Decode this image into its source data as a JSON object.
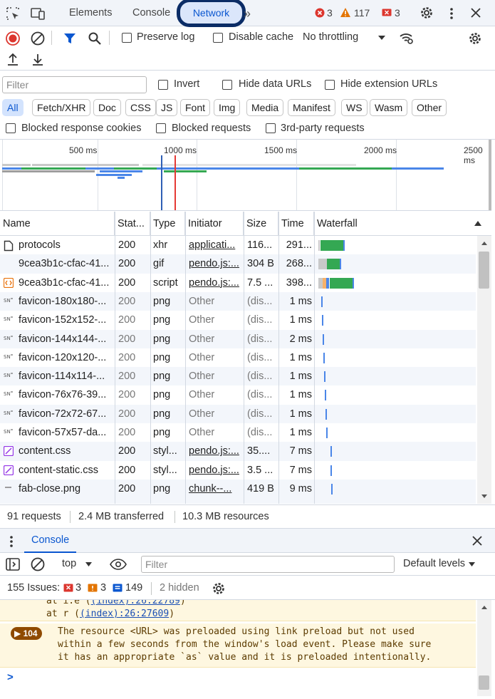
{
  "top_tabs": [
    "Elements",
    "Console",
    "Network"
  ],
  "counts": {
    "errors": "3",
    "warnings": "117",
    "issues": "3"
  },
  "toolbar": {
    "preserve_log": "Preserve log",
    "disable_cache": "Disable cache",
    "throttling": "No throttling"
  },
  "filter": {
    "placeholder": "Filter",
    "invert": "Invert",
    "hide_data_urls": "Hide data URLs",
    "hide_extension_urls": "Hide extension URLs"
  },
  "types": [
    "All",
    "Fetch/XHR",
    "Doc",
    "CSS",
    "JS",
    "Font",
    "Img",
    "Media",
    "Manifest",
    "WS",
    "Wasm",
    "Other"
  ],
  "blocked": {
    "cookies": "Blocked response cookies",
    "requests": "Blocked requests",
    "third_party": "3rd-party requests"
  },
  "overview": {
    "ticks": [
      "500 ms",
      "1000 ms",
      "1500 ms",
      "2000 ms",
      "2500 ms"
    ]
  },
  "columns": [
    "Name",
    "Stat...",
    "Type",
    "Initiator",
    "Size",
    "Time",
    "Waterfall"
  ],
  "rows": [
    {
      "name": "protocols",
      "status": "200",
      "type": "xhr",
      "initiator": "applicati...",
      "size": "116...",
      "time": "291...",
      "icon": "document-icon"
    },
    {
      "name": "9cea3b1c-cfac-41...",
      "status": "200",
      "type": "gif",
      "initiator": "pendo.js:...",
      "size": "304 B",
      "time": "268...",
      "icon": "none"
    },
    {
      "name": "9cea3b1c-cfac-41...",
      "status": "200",
      "type": "script",
      "initiator": "pendo.js:...",
      "size": "7.5 ...",
      "time": "398...",
      "icon": "script-icon"
    },
    {
      "name": "favicon-180x180-...",
      "status": "200",
      "type": "png",
      "initiator": "Other",
      "size": "(dis...",
      "time": "1 ms",
      "icon": "image-icon"
    },
    {
      "name": "favicon-152x152-...",
      "status": "200",
      "type": "png",
      "initiator": "Other",
      "size": "(dis...",
      "time": "1 ms",
      "icon": "image-icon"
    },
    {
      "name": "favicon-144x144-...",
      "status": "200",
      "type": "png",
      "initiator": "Other",
      "size": "(dis...",
      "time": "2 ms",
      "icon": "image-icon"
    },
    {
      "name": "favicon-120x120-...",
      "status": "200",
      "type": "png",
      "initiator": "Other",
      "size": "(dis...",
      "time": "1 ms",
      "icon": "image-icon"
    },
    {
      "name": "favicon-114x114-...",
      "status": "200",
      "type": "png",
      "initiator": "Other",
      "size": "(dis...",
      "time": "1 ms",
      "icon": "image-icon"
    },
    {
      "name": "favicon-76x76-39...",
      "status": "200",
      "type": "png",
      "initiator": "Other",
      "size": "(dis...",
      "time": "1 ms",
      "icon": "image-icon"
    },
    {
      "name": "favicon-72x72-67...",
      "status": "200",
      "type": "png",
      "initiator": "Other",
      "size": "(dis...",
      "time": "1 ms",
      "icon": "image-icon"
    },
    {
      "name": "favicon-57x57-da...",
      "status": "200",
      "type": "png",
      "initiator": "Other",
      "size": "(dis...",
      "time": "1 ms",
      "icon": "image-icon"
    },
    {
      "name": "content.css",
      "status": "200",
      "type": "styl...",
      "initiator": "pendo.js:...",
      "size": "35....",
      "time": "7 ms",
      "icon": "stylesheet-icon"
    },
    {
      "name": "content-static.css",
      "status": "200",
      "type": "styl...",
      "initiator": "pendo.js:...",
      "size": "3.5 ...",
      "time": "7 ms",
      "icon": "stylesheet-icon"
    },
    {
      "name": "fab-close.png",
      "status": "200",
      "type": "png",
      "initiator": "chunk--...",
      "size": "419 B",
      "time": "9 ms",
      "icon": "image-dash-icon"
    }
  ],
  "summary": {
    "requests": "91 requests",
    "transferred": "2.4 MB transferred",
    "resources": "10.3 MB resources"
  },
  "drawer": {
    "tab": "Console"
  },
  "console_toolbar": {
    "context": "top",
    "filter_placeholder": "Filter",
    "levels": "Default levels"
  },
  "issues": {
    "label": "155 Issues:",
    "errors": "3",
    "warnings": "3",
    "info": "149",
    "hidden": "2 hidden"
  },
  "console": {
    "stack": [
      {
        "prefix": "at i.e (",
        "link": "(index):26:22789",
        "suffix": ")"
      },
      {
        "prefix": "at r (",
        "link": "(index):26:27609",
        "suffix": ")"
      }
    ],
    "badge": "104",
    "message_lines": [
      "The resource <URL> was preloaded using link preload but not used",
      "within a few seconds from the window's load event. Please make sure",
      "it has an appropriate `as` value and it is preloaded intentionally."
    ],
    "prompt": ">"
  },
  "colors": {
    "accent": "#0b57d0",
    "error": "#dc362e",
    "warning": "#e37400",
    "selected_tab_ring": "#0b2c66"
  }
}
